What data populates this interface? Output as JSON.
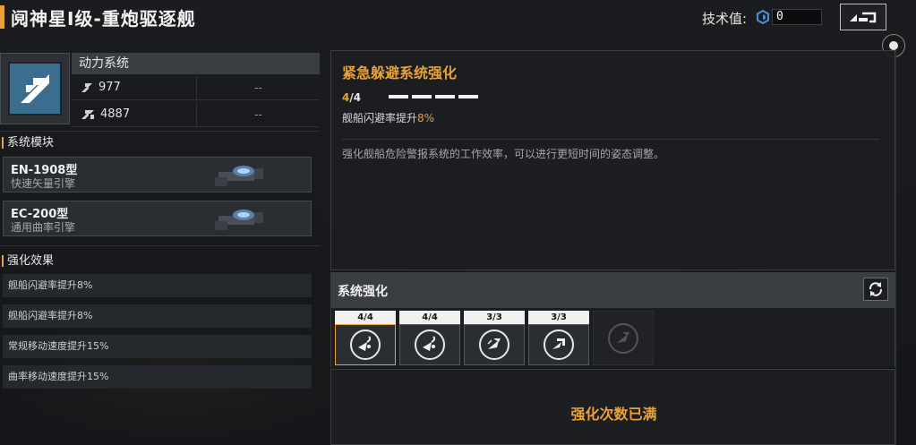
{
  "header": {
    "title": "阋神星Ⅰ级-重炮驱逐舰",
    "tech_label": "技术值:",
    "tech_value": "0"
  },
  "system": {
    "name": "动力系统",
    "stats": [
      {
        "icon": "speed-icon",
        "value": "977",
        "extra": "--"
      },
      {
        "icon": "warp-speed-icon",
        "value": "4887",
        "extra": "--"
      }
    ]
  },
  "modules": {
    "heading": "系统模块",
    "items": [
      {
        "name": "EN-1908型",
        "desc": "快速矢量引擎"
      },
      {
        "name": "EC-200型",
        "desc": "通用曲率引擎"
      }
    ]
  },
  "effects": {
    "heading": "强化效果",
    "items": [
      "舰船闪避率提升8%",
      "舰船闪避率提升8%",
      "常规移动速度提升15%",
      "曲率移动速度提升15%"
    ]
  },
  "detail": {
    "title": "紧急躲避系统强化",
    "level_current": "4",
    "level_sep": "/",
    "level_max": "4",
    "effect_prefix": "舰船闪避率提升",
    "effect_value": "8%",
    "description": "强化舰船危险警报系统的工作效率，可以进行更短时间的姿态调整。"
  },
  "enhance": {
    "title": "系统强化",
    "slots": [
      {
        "badge": "4/4",
        "icon": "evade-icon",
        "active": true
      },
      {
        "badge": "4/4",
        "icon": "evade-icon",
        "active": false
      },
      {
        "badge": "3/3",
        "icon": "speed-boost-icon",
        "active": false
      },
      {
        "badge": "3/3",
        "icon": "warp-boost-icon",
        "active": false
      },
      {
        "badge": "",
        "icon": "locked-boost-icon",
        "active": false
      }
    ],
    "full_text": "强化次数已满"
  },
  "colors": {
    "accent": "#e8a23a",
    "panel": "#2a2d31",
    "icon_blue": "#3b6d8e"
  }
}
